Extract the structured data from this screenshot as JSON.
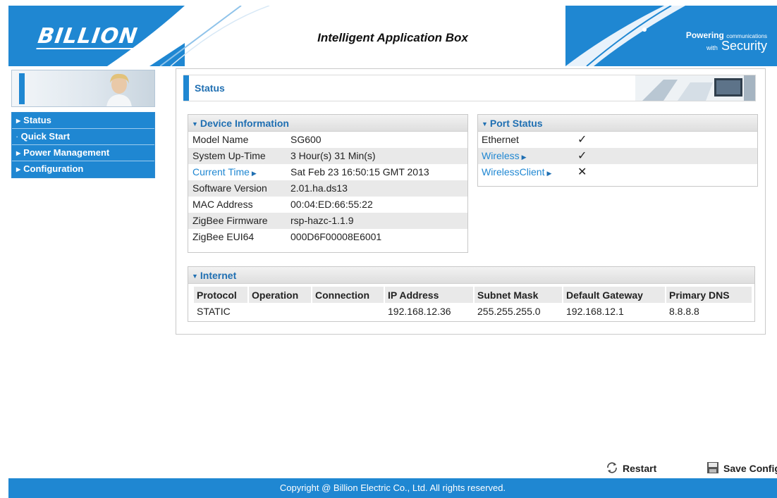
{
  "header": {
    "logo": "BILLION",
    "title": "Intelligent Application Box",
    "tagline_powering": "Powering",
    "tagline_communications": "communications",
    "tagline_with": "with",
    "tagline_security": "Security"
  },
  "nav": {
    "items": [
      {
        "label": "Status",
        "icon": "triangle-right-icon"
      },
      {
        "label": "Quick Start",
        "icon": "dot-icon"
      },
      {
        "label": "Power Management",
        "icon": "triangle-right-icon"
      },
      {
        "label": "Configuration",
        "icon": "triangle-right-icon"
      }
    ]
  },
  "page": {
    "title": "Status"
  },
  "device_info": {
    "title": "Device Information",
    "rows": [
      {
        "key": "Model Name",
        "value": "SG600"
      },
      {
        "key": "System Up-Time",
        "value": "3 Hour(s) 31 Min(s)"
      },
      {
        "key": "Current Time",
        "value": "Sat Feb 23 16:50:15 GMT 2013"
      },
      {
        "key": "Software Version",
        "value": "2.01.ha.ds13"
      },
      {
        "key": "MAC Address",
        "value": "00:04:ED:66:55:22"
      },
      {
        "key": "ZigBee Firmware",
        "value": "rsp-hazc-1.1.9"
      },
      {
        "key": "ZigBee EUI64",
        "value": "000D6F00008E6001"
      }
    ]
  },
  "port_status": {
    "title": "Port Status",
    "rows": [
      {
        "key": "Ethernet",
        "status": "check-icon"
      },
      {
        "key": "Wireless",
        "status": "check-icon"
      },
      {
        "key": "WirelessClient",
        "status": "cross-icon"
      }
    ],
    "glyph_ok": "✓",
    "glyph_bad": "✕"
  },
  "internet": {
    "title": "Internet",
    "columns": [
      "Protocol",
      "Operation",
      "Connection",
      "IP Address",
      "Subnet Mask",
      "Default Gateway",
      "Primary DNS"
    ],
    "rows": [
      [
        "STATIC",
        "",
        "",
        "192.168.12.36",
        "255.255.255.0",
        "192.168.12.1",
        "8.8.8.8"
      ]
    ]
  },
  "actions": {
    "restart": "Restart",
    "save": "Save Config"
  },
  "footer": {
    "copyright": "Copyright @ Billion Electric Co., Ltd. All rights reserved."
  },
  "colors": {
    "brand_blue": "#1f87d2",
    "link_blue": "#1f6fb2",
    "ok_green": "#18a018",
    "bad_red": "#e02020"
  }
}
